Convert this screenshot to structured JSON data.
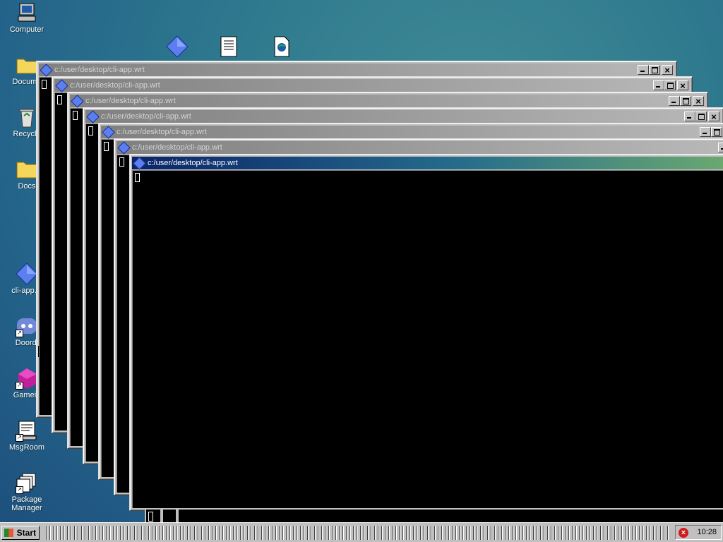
{
  "desktop": {
    "icons": [
      {
        "label": "Computer",
        "icon": "computer-icon"
      },
      {
        "label": "Docume",
        "icon": "folder-icon"
      },
      {
        "label": "Recycle",
        "icon": "recycle-bin-icon"
      },
      {
        "label": "Docs",
        "icon": "folder-icon"
      },
      {
        "label": "cli-app.w",
        "icon": "diamond-app-icon"
      },
      {
        "label": "Doordi",
        "icon": "discord-icon"
      },
      {
        "label": "Gamein",
        "icon": "game-icon"
      },
      {
        "label": "MsgRoom",
        "icon": "msgroom-icon"
      },
      {
        "label": "Package Manager",
        "icon": "package-manager-icon"
      }
    ],
    "top_icons": [
      {
        "icon": "diamond-app-icon"
      },
      {
        "icon": "text-document-icon"
      },
      {
        "icon": "web-document-icon"
      }
    ]
  },
  "windows": [
    {
      "title": "c:/user/desktop/cli-app.wrt",
      "active": false
    },
    {
      "title": "c:/user/desktop/cli-app.wrt",
      "active": false
    },
    {
      "title": "c:/user/desktop/cli-app.wrt",
      "active": false
    },
    {
      "title": "c:/user/desktop/cli-app.wrt",
      "active": false
    },
    {
      "title": "c:/user/desktop/cli-app.wrt",
      "active": false
    },
    {
      "title": "c:/user/desktop/cli-app.wrt",
      "active": false
    },
    {
      "title": "c:/user/desktop/cli-app.wrt",
      "active": true
    }
  ],
  "taskbar": {
    "start_label": "Start",
    "clock": "10:28",
    "tray_icon": "error-icon"
  },
  "colors": {
    "active_title_start": "#0a246a",
    "active_title_end": "#6aa870",
    "inactive_title": "#808080",
    "terminal_bg": "#000000",
    "desktop": "#2f7a8e"
  }
}
